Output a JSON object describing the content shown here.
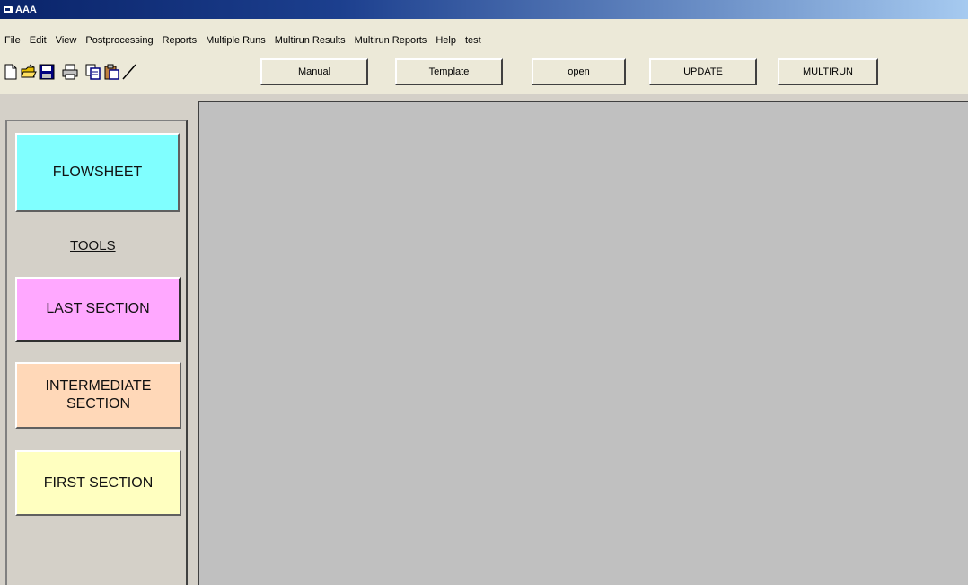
{
  "window": {
    "title": "AAA"
  },
  "menu": {
    "items": [
      "File",
      "Edit",
      "View",
      "Postprocessing",
      "Reports",
      "Multiple Runs",
      "Multirun Results",
      "Multirun Reports",
      "Help",
      "test"
    ]
  },
  "toolbar": {
    "icons": [
      "new-file-icon",
      "open-folder-icon",
      "save-icon",
      "print-icon",
      "copy-icon",
      "paste-icon",
      "draw-line-icon"
    ],
    "buttons": {
      "manual": "Manual",
      "template": "Template",
      "open": "open",
      "update": "UPDATE",
      "multirun": "MULTIRUN"
    }
  },
  "sidebar": {
    "flowsheet": "FLOWSHEET",
    "tools_label": "TOOLS",
    "last_section": "LAST SECTION",
    "intermediate_section_line1": "INTERMEDIATE",
    "intermediate_section_line2": "SECTION",
    "first_section": "FIRST SECTION"
  },
  "colors": {
    "flowsheet": "#80ffff",
    "last_section": "#ffa8ff",
    "intermediate_section": "#ffd8b8",
    "first_section": "#ffffc0",
    "main_area": "#c0c0c0"
  }
}
